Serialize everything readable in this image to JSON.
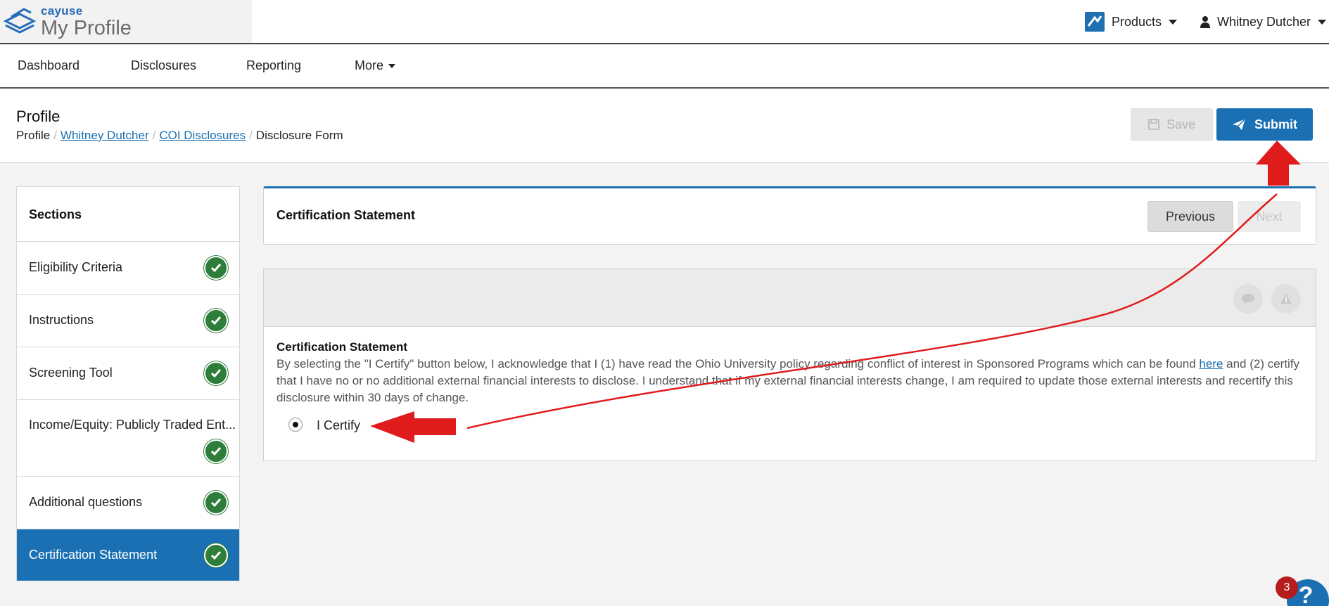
{
  "brand": {
    "name": "cayuse",
    "product": "My Profile"
  },
  "topbar": {
    "products_label": "Products",
    "user_name": "Whitney Dutcher"
  },
  "nav": {
    "items": [
      "Dashboard",
      "Disclosures",
      "Reporting",
      "More"
    ]
  },
  "header": {
    "title": "Profile",
    "breadcrumb": {
      "root": "Profile",
      "user": "Whitney Dutcher",
      "section": "COI Disclosures",
      "current": "Disclosure Form",
      "separator": "/"
    },
    "save_label": "Save",
    "submit_label": "Submit"
  },
  "sidebar": {
    "heading": "Sections",
    "items": [
      {
        "label": "Eligibility Criteria",
        "complete": true
      },
      {
        "label": "Instructions",
        "complete": true
      },
      {
        "label": "Screening Tool",
        "complete": true
      },
      {
        "label": "Income/Equity: Publicly Traded Ent...",
        "complete": true
      },
      {
        "label": "Additional questions",
        "complete": true
      },
      {
        "label": "Certification Statement",
        "complete": true,
        "active": true
      }
    ]
  },
  "section_panel": {
    "title": "Certification Statement",
    "previous_label": "Previous",
    "next_label": "Next"
  },
  "question": {
    "title": "Certification Statement",
    "text_before_link": "By selecting the \"I Certify\" button below, I acknowledge that I (1) have read the Ohio University policy regarding conflict of interest in Sponsored Programs which can be found ",
    "link_text": "here",
    "text_after_link": " and (2) certify that I have no or no additional external financial interests to disclose.  I understand that if my external financial interests change, I am required to update those external interests and recertify this disclosure within 30 days of change.",
    "option_label": "I Certify",
    "option_selected": true
  },
  "help": {
    "badge_count": "3",
    "icon": "?"
  },
  "colors": {
    "primary": "#1a70b3",
    "success": "#2e7d3a",
    "annotation": "#e01b1b"
  }
}
